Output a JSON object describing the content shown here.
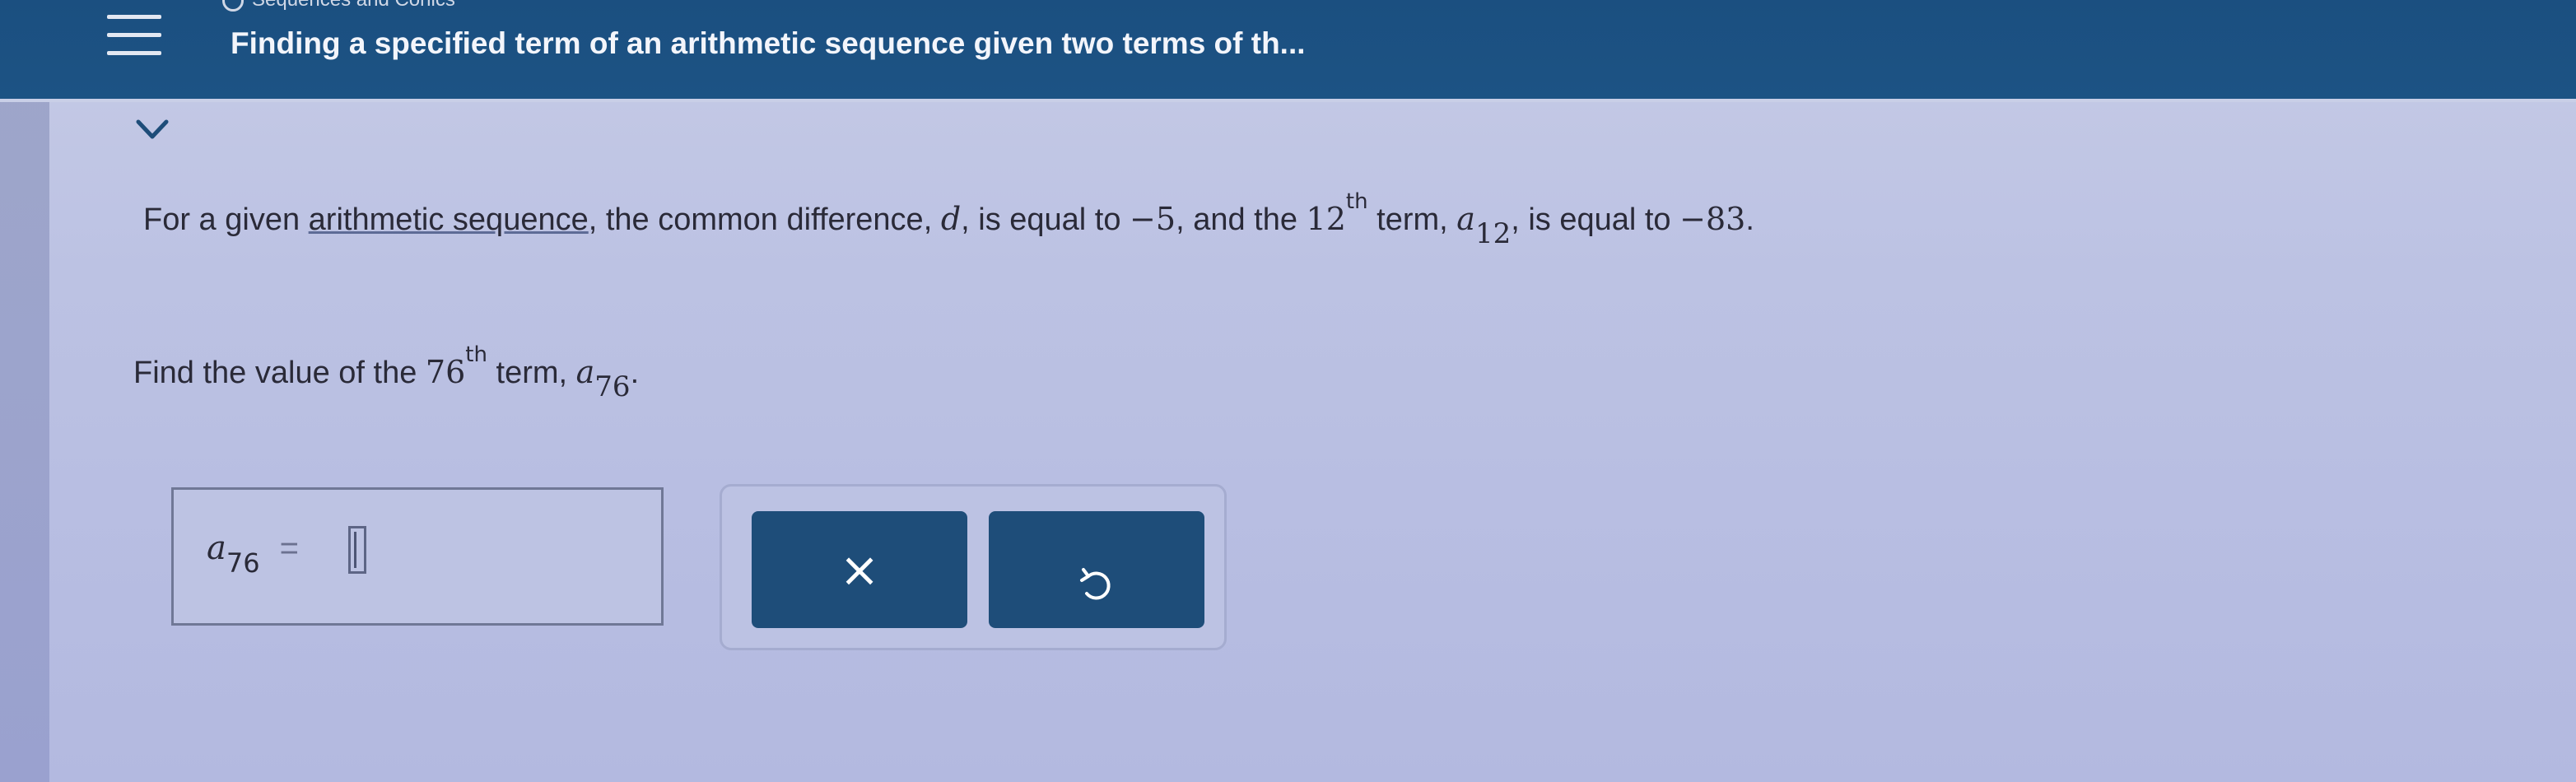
{
  "header": {
    "topic": "Sequences and Conics",
    "title": "Finding a specified term of an arithmetic sequence given two terms of th..."
  },
  "icons": {
    "menu": "hamburger-menu-icon",
    "collapse": "chevron-down-icon",
    "clear": "close-icon",
    "undo": "undo-icon"
  },
  "problem": {
    "line1": {
      "intro": "For a given ",
      "link": "arithmetic sequence",
      "after_link": ", the common difference, ",
      "d_var": "d",
      "equal_to": ", is equal to ",
      "d_value": "−5",
      "and_the": ", and the ",
      "n1_num": "12",
      "n1_ord": "th",
      "term_word": " term, ",
      "a_var": "a",
      "n1_sub": "12",
      "comma": ",",
      "is_equal": " is equal to ",
      "a12_value": "−83",
      "period": "."
    },
    "line2": {
      "find": "Find the value of the ",
      "n2_num": "76",
      "n2_ord": "th",
      "term_word": " term, ",
      "a_var": "a",
      "n2_sub": "76",
      "period": "."
    }
  },
  "answer": {
    "var": "a",
    "sub": "76",
    "equals": "=",
    "value": ""
  },
  "colors": {
    "header": "#1c5384",
    "background": "#bcc2e3",
    "button": "#1e4d79",
    "button_text": "#ffffff"
  }
}
